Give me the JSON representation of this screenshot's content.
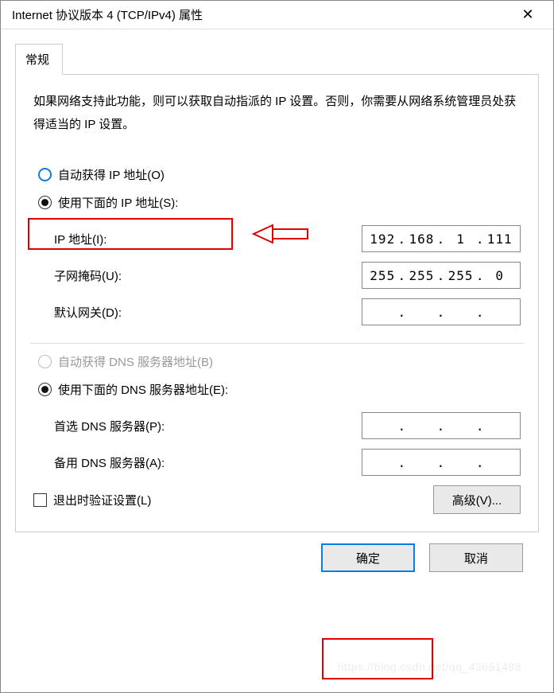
{
  "window": {
    "title": "Internet 协议版本 4 (TCP/IPv4) 属性"
  },
  "tab": {
    "general": "常规"
  },
  "description": "如果网络支持此功能，则可以获取自动指派的 IP 设置。否则，你需要从网络系统管理员处获得适当的 IP 设置。",
  "ip_section": {
    "auto_label": "自动获得 IP 地址(O)",
    "manual_label": "使用下面的 IP 地址(S):",
    "ip_label": "IP 地址(I):",
    "ip_value": [
      "192",
      "168",
      "1",
      "111"
    ],
    "subnet_label": "子网掩码(U):",
    "subnet_value": [
      "255",
      "255",
      "255",
      "0"
    ],
    "gateway_label": "默认网关(D):",
    "gateway_value": [
      "",
      "",
      "",
      ""
    ]
  },
  "dns_section": {
    "auto_label": "自动获得 DNS 服务器地址(B)",
    "manual_label": "使用下面的 DNS 服务器地址(E):",
    "pref_label": "首选 DNS 服务器(P):",
    "pref_value": [
      "",
      "",
      "",
      ""
    ],
    "alt_label": "备用 DNS 服务器(A):",
    "alt_value": [
      "",
      "",
      "",
      ""
    ]
  },
  "validate_label": "退出时验证设置(L)",
  "buttons": {
    "advanced": "高级(V)...",
    "ok": "确定",
    "cancel": "取消"
  },
  "watermark": "https://blog.csdn.net/qq_43661488"
}
